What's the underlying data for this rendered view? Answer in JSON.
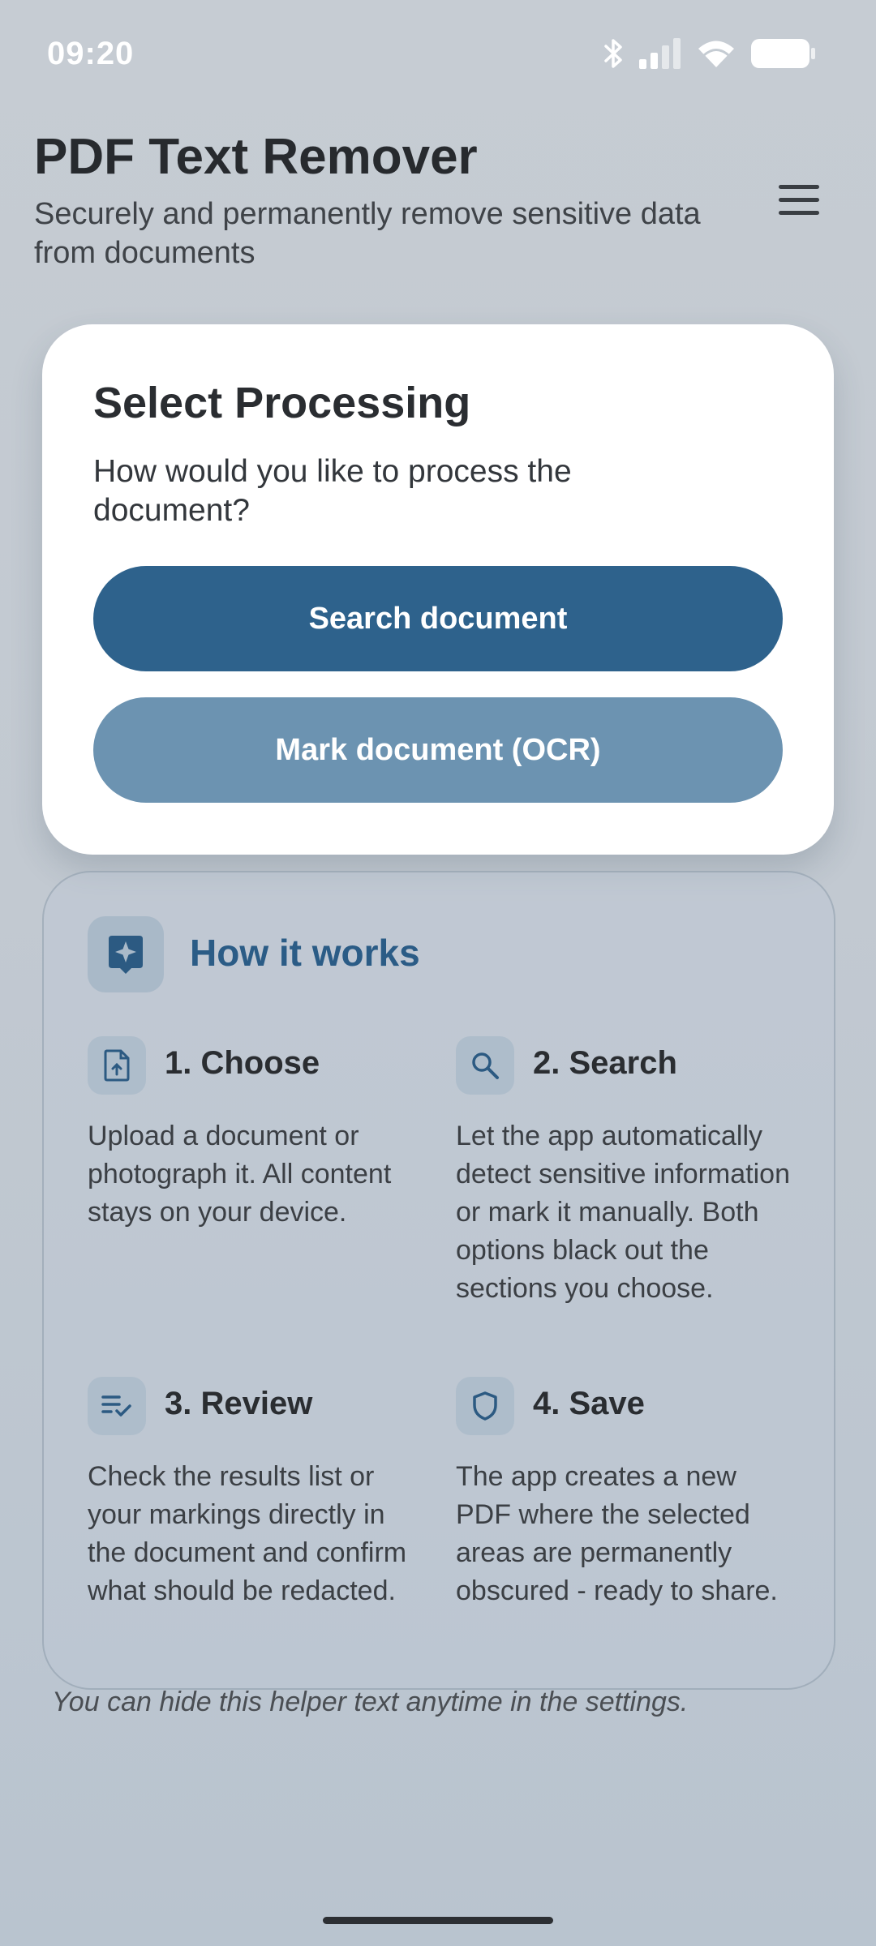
{
  "status_bar": {
    "time": "09:20",
    "icons": [
      "bluetooth-icon",
      "signal-icon",
      "wifi-icon",
      "battery-icon"
    ]
  },
  "header": {
    "title": "PDF Text Remover",
    "subtitle": "Securely and permanently remove sensitive data from documents",
    "menu_icon": "hamburger-menu-icon"
  },
  "processing_card": {
    "title": "Select Processing",
    "question": "How would you like to process the document?",
    "primary_button": "Search document",
    "secondary_button": "Mark document (OCR)"
  },
  "how_it_works": {
    "title": "How it works",
    "icon": "sparkle-icon",
    "steps": [
      {
        "icon": "upload-file-icon",
        "title": "1. Choose",
        "text": "Upload a document or photograph it. All content stays on your device."
      },
      {
        "icon": "search-icon",
        "title": "2. Search",
        "text": "Let the app automatically detect sensitive information or mark it manually. Both options black out the sections you choose."
      },
      {
        "icon": "checklist-icon",
        "title": "3. Review",
        "text": "Check the results list or your markings directly in the document and confirm what should be redacted."
      },
      {
        "icon": "shield-icon",
        "title": "4. Save",
        "text": "The app creates a new PDF where the selected areas are permanently obscured - ready to share."
      }
    ]
  },
  "footer_note": "You can hide this helper text anytime in the settings.",
  "colors": {
    "primary": "#2e628c",
    "secondary": "#6c93b1",
    "accent_text": "#2b5c86",
    "background": "#c4cbd2"
  }
}
